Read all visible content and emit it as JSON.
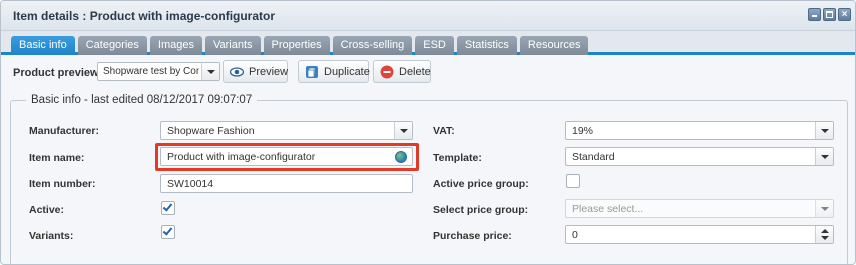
{
  "window": {
    "title": "Item details : Product with image-configurator"
  },
  "tabs": [
    {
      "label": "Basic info",
      "active": true
    },
    {
      "label": "Categories",
      "active": false
    },
    {
      "label": "Images",
      "active": false
    },
    {
      "label": "Variants",
      "active": false
    },
    {
      "label": "Properties",
      "active": false
    },
    {
      "label": "Cross-selling",
      "active": false
    },
    {
      "label": "ESD",
      "active": false
    },
    {
      "label": "Statistics",
      "active": false
    },
    {
      "label": "Resources",
      "active": false
    }
  ],
  "toolbar": {
    "preview_label": "Product preview:",
    "preview_select_value": "Shopware test by Conte",
    "preview_button": "Preview",
    "duplicate_button": "Duplicate",
    "delete_button": "Delete"
  },
  "form": {
    "legend": "Basic info - last edited 08/12/2017 09:07:07",
    "manufacturer": {
      "label": "Manufacturer:",
      "value": "Shopware Fashion"
    },
    "item_name": {
      "label": "Item name:",
      "value": "Product with image-configurator"
    },
    "item_number": {
      "label": "Item number:",
      "value": "SW10014"
    },
    "active": {
      "label": "Active:",
      "checked": true
    },
    "variants": {
      "label": "Variants:",
      "checked": true
    },
    "vat": {
      "label": "VAT:",
      "value": "19%"
    },
    "template": {
      "label": "Template:",
      "value": "Standard"
    },
    "active_price_group": {
      "label": "Active price group:",
      "checked": false
    },
    "select_price_group": {
      "label": "Select price group:",
      "placeholder": "Please select..."
    },
    "purchase_price": {
      "label": "Purchase price:",
      "value": "0"
    }
  },
  "colors": {
    "accent": "#1e84c8",
    "highlight": "#e23b25",
    "tab_inactive": "#8a96a3"
  }
}
